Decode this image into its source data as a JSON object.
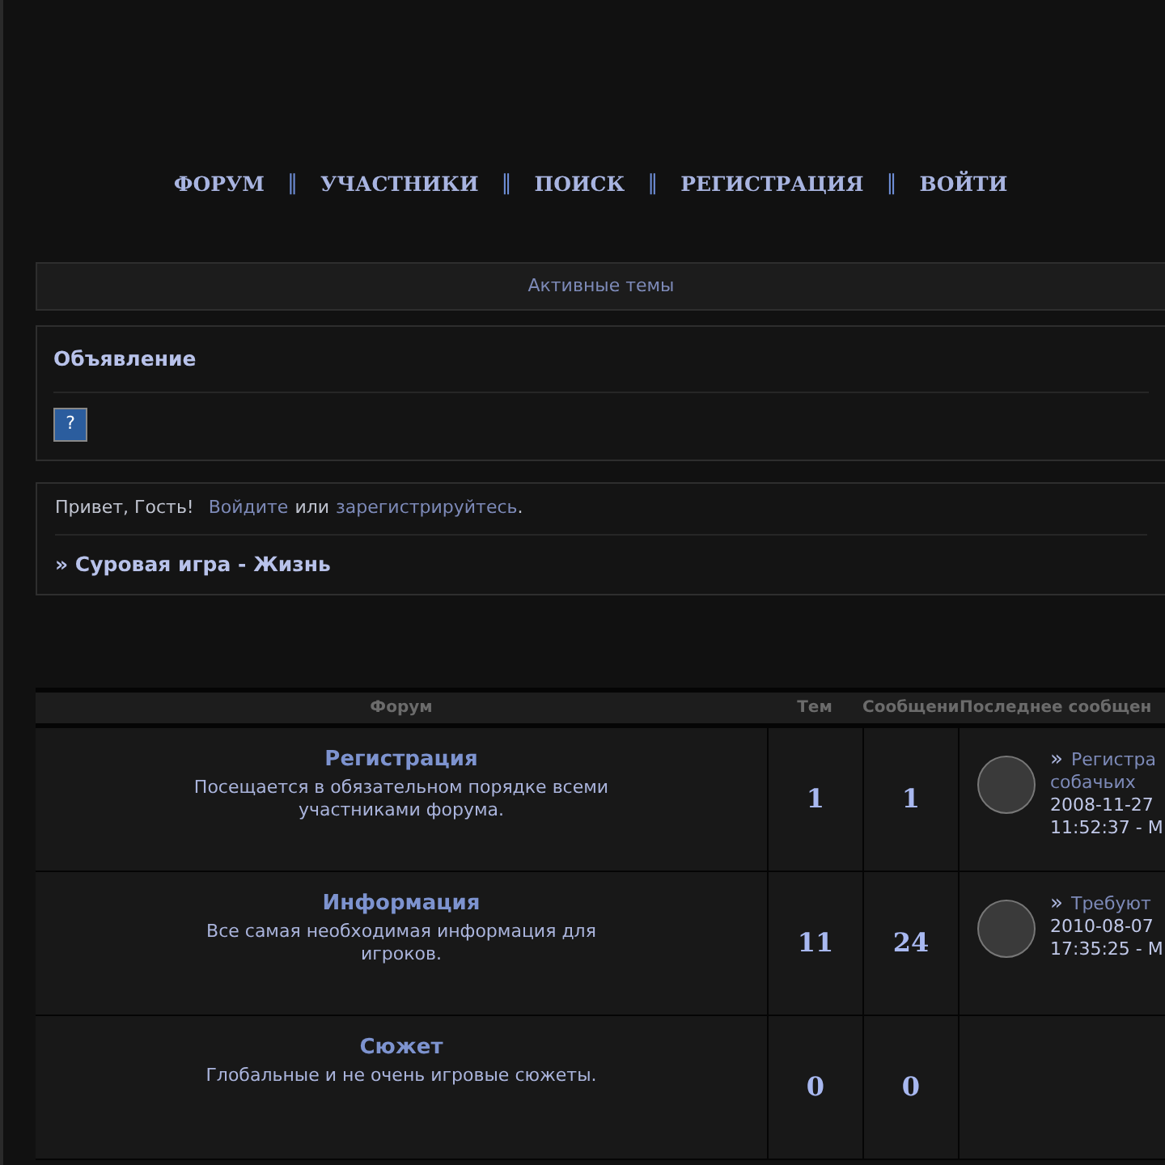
{
  "nav": [
    {
      "label": "ФОРУМ"
    },
    {
      "label": "УЧАСТНИКИ"
    },
    {
      "label": "ПОИСК"
    },
    {
      "label": "РЕГИСТРАЦИЯ"
    },
    {
      "label": "ВОЙТИ"
    }
  ],
  "nav_separator": "‖",
  "active_topics": "Активные темы",
  "announcement": {
    "title": "Объявление",
    "icon_text": "?"
  },
  "welcome": {
    "greeting": "Привет, Гость!",
    "login_link": "Войдите",
    "middle": "или",
    "register_link": "зарегистрируйтесь",
    "end": ".",
    "breadcrumb": "» Суровая игра - Жизнь"
  },
  "table": {
    "columns": [
      "Форум",
      "Тем",
      "Сообщени",
      "Последнее сообщен"
    ],
    "rows": [
      {
        "title": "Регистрация",
        "description": "Посещается в обязательном порядке всеми участниками форума.",
        "topics": "1",
        "posts": "1",
        "last_post": {
          "marker": "»",
          "title": "Регистра",
          "title_2": "собачьих",
          "date": "2008-11-27",
          "time": "11:52:37 - М"
        }
      },
      {
        "title": "Информация",
        "description": "Все самая необходимая информация для игроков.",
        "topics": "11",
        "posts": "24",
        "last_post": {
          "marker": "»",
          "title": "Требуют",
          "date": "2010-08-07",
          "time": "17:35:25 - М"
        }
      },
      {
        "title": "Сюжет",
        "description": "Глобальные и не очень игровые сюжеты.",
        "topics": "0",
        "posts": "0"
      }
    ]
  }
}
